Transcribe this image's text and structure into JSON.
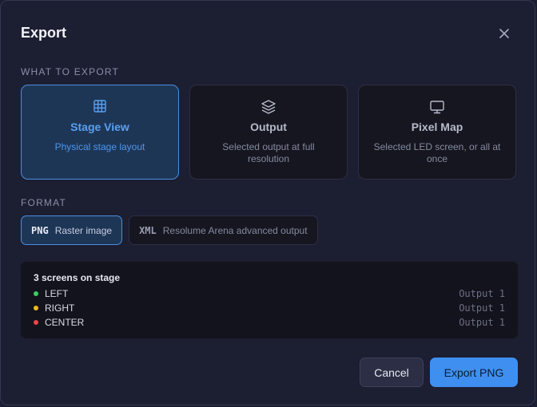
{
  "dialog": {
    "title": "Export",
    "close_icon": "close-icon"
  },
  "what_to_export": {
    "label": "WHAT TO EXPORT",
    "options": [
      {
        "title": "Stage View",
        "description": "Physical stage layout",
        "icon": "grid-icon",
        "selected": true
      },
      {
        "title": "Output",
        "description": "Selected output at full resolution",
        "icon": "layers-icon",
        "selected": false
      },
      {
        "title": "Pixel Map",
        "description": "Selected LED screen, or all at once",
        "icon": "monitor-icon",
        "selected": false
      }
    ]
  },
  "format": {
    "label": "FORMAT",
    "options": [
      {
        "code": "PNG",
        "description": "Raster image",
        "selected": true
      },
      {
        "code": "XML",
        "description": "Resolume Arena advanced output",
        "selected": false
      }
    ]
  },
  "screens": {
    "title": "3 screens on stage",
    "items": [
      {
        "name": "LEFT",
        "output": "Output 1",
        "color": "#3ccf63"
      },
      {
        "name": "RIGHT",
        "output": "Output 1",
        "color": "#f2b81c"
      },
      {
        "name": "CENTER",
        "output": "Output 1",
        "color": "#ef4444"
      }
    ]
  },
  "actions": {
    "cancel_label": "Cancel",
    "export_label": "Export PNG"
  },
  "colors": {
    "accent": "#3f8ff0",
    "background": "#1c1e31"
  }
}
